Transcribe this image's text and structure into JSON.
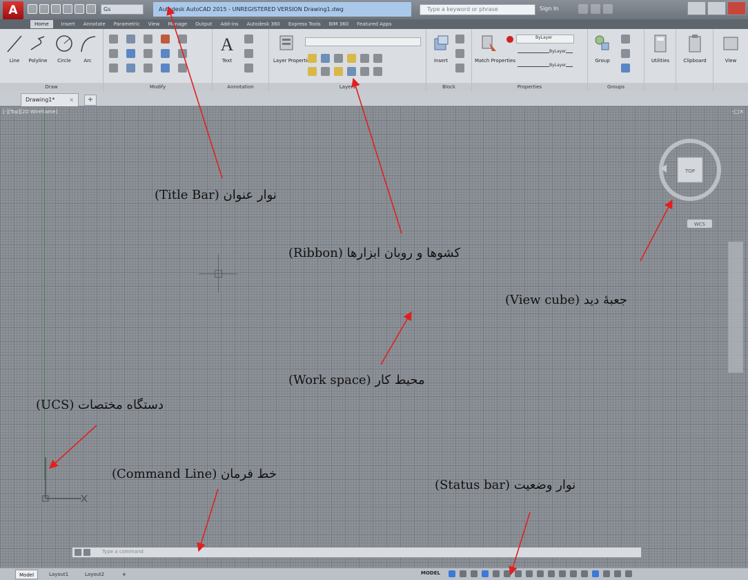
{
  "title_bar": {
    "app_button_label": "A",
    "workspace_dropdown": "Gs",
    "window_title": "Autodesk AutoCAD 2015 - UNREGISTERED VERSION   Drawing1.dwg",
    "search_placeholder": "Type a keyword or phrase",
    "sign_in_label": "Sign In"
  },
  "ribbon_tabs": [
    "Home",
    "Insert",
    "Annotate",
    "Parametric",
    "View",
    "Manage",
    "Output",
    "Add-ins",
    "Autodesk 360",
    "Express Tools",
    "BIM 360",
    "Featured Apps"
  ],
  "ribbon": {
    "draw": {
      "title": "Draw",
      "tools": [
        "Line",
        "Polyline",
        "Circle",
        "Arc"
      ]
    },
    "modify": {
      "title": "Modify"
    },
    "annotation": {
      "title": "Annotation",
      "tools": [
        "Text"
      ]
    },
    "layers": {
      "title": "Layers",
      "tools": [
        "Layer Properties"
      ]
    },
    "block": {
      "title": "Block",
      "tools": [
        "Insert"
      ]
    },
    "properties": {
      "title": "Properties",
      "tools": [
        "Match Properties"
      ],
      "rows": [
        "ByLayer",
        "ByLayer",
        "ByLayer"
      ]
    },
    "groups": {
      "title": "Groups",
      "tools": [
        "Group"
      ]
    },
    "utilities": {
      "title": "",
      "tools": [
        "Utilities"
      ]
    },
    "clipboard": {
      "title": "",
      "tools": [
        "Clipboard"
      ]
    },
    "view": {
      "title": "",
      "tools": [
        "View"
      ]
    }
  },
  "document": {
    "tab_label": "Drawing1*",
    "close_label": "×",
    "new_tab_label": "+"
  },
  "viewport": {
    "label": "[-][Top][2D Wireframe]",
    "controls": "-□×",
    "viewcube_face": "TOP",
    "viewcube_wcs": "WCS"
  },
  "command_line": {
    "prompt": "Type a command"
  },
  "layout_tabs": [
    "Model",
    "Layout1",
    "Layout2"
  ],
  "new_layout_label": "+",
  "status_bar": {
    "model_label": "MODEL"
  },
  "annotations": {
    "title_bar": "نوار عنوان (Title Bar)",
    "ribbon": "کشوها و روبان ابزارها (Ribbon)",
    "view_cube": "جعبهٔ دید (View cube)",
    "work_space": "محیط کار (Work space)",
    "ucs": "دستگاه مختصات (UCS)",
    "command_line": "خط فرمان (Command Line)",
    "status_bar": "نوار وضعیت (Status bar)"
  },
  "colors": {
    "arrow": "#e02020",
    "app_button": "#c62828",
    "title_highlight": "#aac8ea",
    "workspace": "#8d9299"
  }
}
